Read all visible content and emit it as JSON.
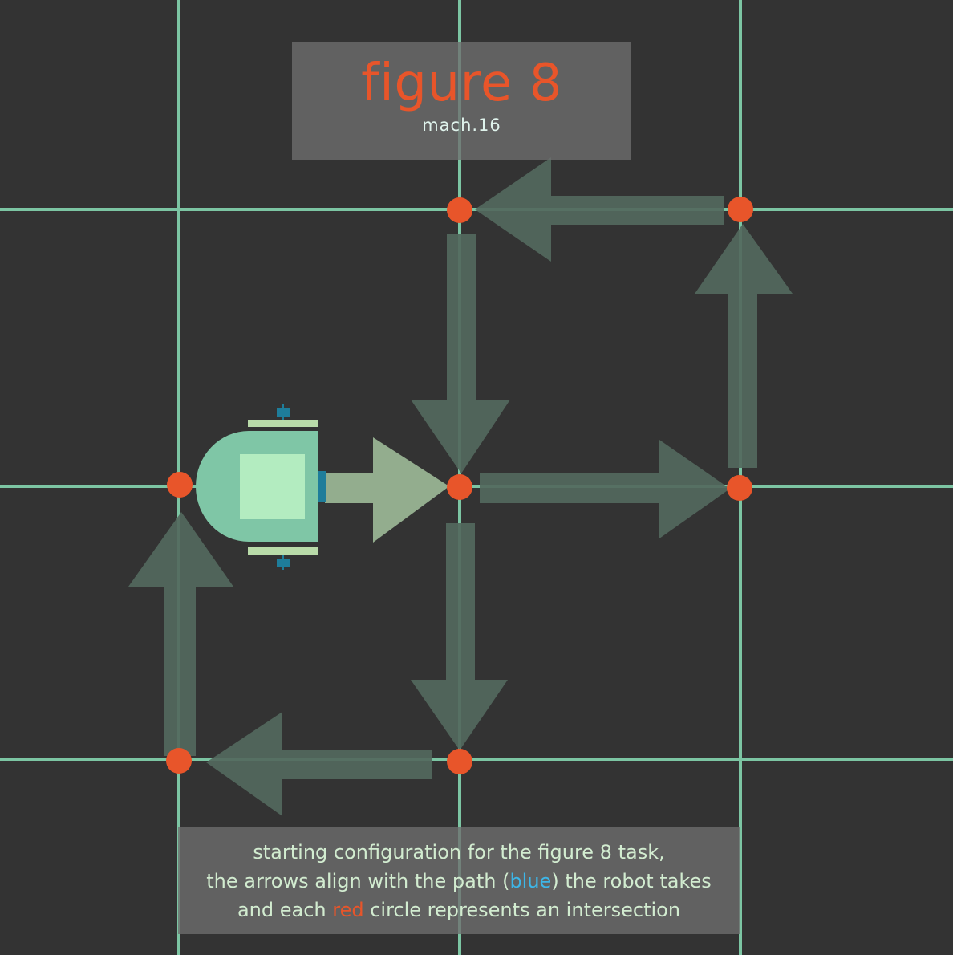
{
  "title": "figure 8",
  "subtitle": "mach.16",
  "caption": {
    "line1": "starting configuration for the figure 8 task,",
    "line2_pre": "the arrows align with the path (",
    "line2_blue": "blue",
    "line2_post": ") the robot takes",
    "line3_pre": "and each ",
    "line3_red": "red",
    "line3_post": " circle represents an intersection"
  },
  "colors": {
    "background": "#333333",
    "grid_line": "#7cc5a3",
    "intersection": "#e8552a",
    "path_arrow": "#52685d",
    "robot_arrow": "#93ad8e",
    "robot_body": "#7fc6a6",
    "robot_core": "#b3ecc0",
    "robot_sensor": "#1e7d9a",
    "highlight_blue": "#3db6e8",
    "highlight_red": "#e8552a"
  },
  "icons": {
    "robot": "robot-icon",
    "intersection": "red-circle"
  }
}
